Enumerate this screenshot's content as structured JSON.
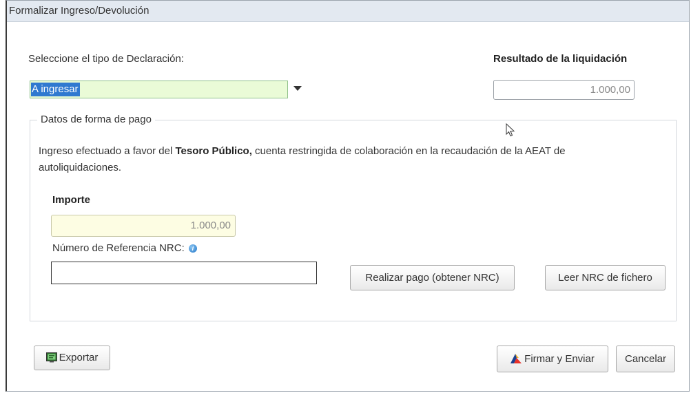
{
  "window": {
    "title": "Formalizar Ingreso/Devolución"
  },
  "declaracion": {
    "label": "Seleccione el tipo de Declaración:",
    "selected": "A ingresar"
  },
  "resultado": {
    "label": "Resultado de la liquidación",
    "value": "1.000,00"
  },
  "pago": {
    "legend": "Datos de forma de pago",
    "text_prefix": "Ingreso efectuado a favor del ",
    "text_bold": "Tesoro Público,",
    "text_suffix": " cuenta restringida de colaboración en la recaudación de la AEAT de",
    "text_line2": "autoliquidaciones.",
    "importe_label": "Importe",
    "importe_value": "1.000,00",
    "nrc_label": "Número de Referencia  NRC:",
    "nrc_value": "",
    "realizar_pago_label": "Realizar pago (obtener NRC)",
    "leer_nrc_label": "Leer NRC de fichero"
  },
  "footer": {
    "exportar_label": "Exportar",
    "firmar_label": "Firmar y Enviar",
    "cancelar_label": "Cancelar"
  },
  "colors": {
    "titlebar": "#e3e9f1",
    "select_bg": "#eafbd7",
    "selection": "#2f79d0",
    "importe_bg": "#fdfde3"
  }
}
